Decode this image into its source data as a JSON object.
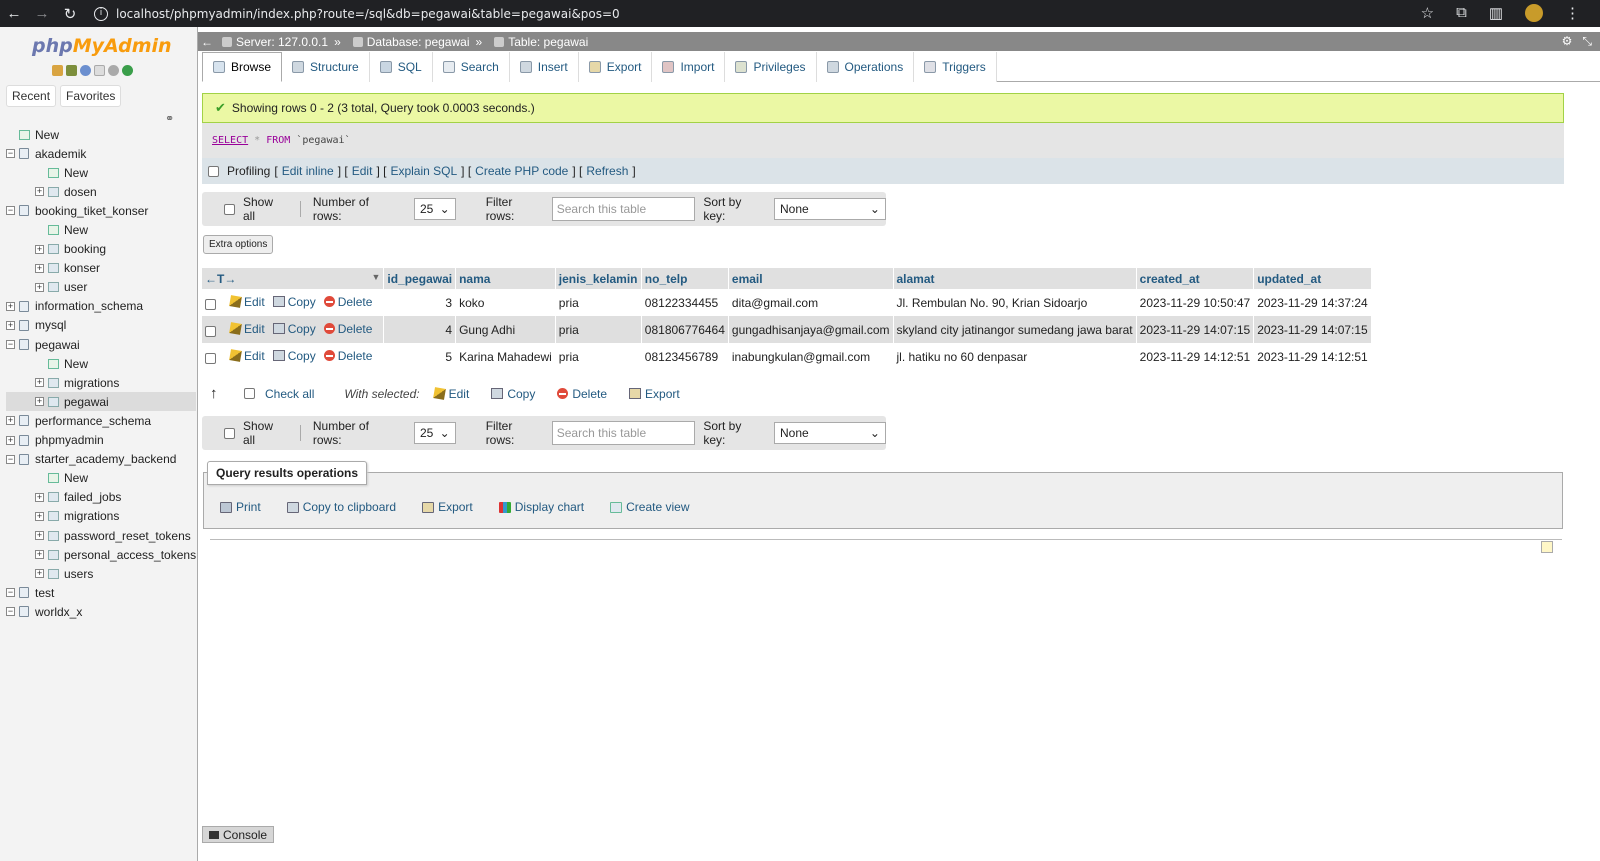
{
  "browser": {
    "url": "localhost/phpmyadmin/index.php?route=/sql&db=pegawai&table=pegawai&pos=0"
  },
  "sidebar": {
    "logo_php": "php",
    "logo_myadmin": "MyAdmin",
    "recent": "Recent",
    "favorites": "Favorites",
    "tree": [
      {
        "label": "New",
        "level": 0,
        "type": "new"
      },
      {
        "label": "akademik",
        "level": 0,
        "type": "db"
      },
      {
        "label": "New",
        "level": 1,
        "type": "new"
      },
      {
        "label": "dosen",
        "level": 1,
        "type": "table"
      },
      {
        "label": "booking_tiket_konser",
        "level": 0,
        "type": "db"
      },
      {
        "label": "New",
        "level": 1,
        "type": "new"
      },
      {
        "label": "booking",
        "level": 1,
        "type": "table"
      },
      {
        "label": "konser",
        "level": 1,
        "type": "table"
      },
      {
        "label": "user",
        "level": 1,
        "type": "table"
      },
      {
        "label": "information_schema",
        "level": 0,
        "type": "db"
      },
      {
        "label": "mysql",
        "level": 0,
        "type": "db"
      },
      {
        "label": "pegawai",
        "level": 0,
        "type": "db"
      },
      {
        "label": "New",
        "level": 1,
        "type": "new"
      },
      {
        "label": "migrations",
        "level": 1,
        "type": "table"
      },
      {
        "label": "pegawai",
        "level": 1,
        "type": "table",
        "active": true
      },
      {
        "label": "performance_schema",
        "level": 0,
        "type": "db"
      },
      {
        "label": "phpmyadmin",
        "level": 0,
        "type": "db"
      },
      {
        "label": "starter_academy_backend",
        "level": 0,
        "type": "db"
      },
      {
        "label": "New",
        "level": 1,
        "type": "new"
      },
      {
        "label": "failed_jobs",
        "level": 1,
        "type": "table"
      },
      {
        "label": "migrations",
        "level": 1,
        "type": "table"
      },
      {
        "label": "password_reset_tokens",
        "level": 1,
        "type": "table"
      },
      {
        "label": "personal_access_tokens",
        "level": 1,
        "type": "table"
      },
      {
        "label": "users",
        "level": 1,
        "type": "table"
      },
      {
        "label": "test",
        "level": 0,
        "type": "db"
      },
      {
        "label": "worldx_x",
        "level": 0,
        "type": "db"
      }
    ]
  },
  "breadcrumb": {
    "server": "Server: 127.0.0.1",
    "database": "Database: pegawai",
    "table": "Table: pegawai",
    "sep": "»"
  },
  "tabs": [
    "Browse",
    "Structure",
    "SQL",
    "Search",
    "Insert",
    "Export",
    "Import",
    "Privileges",
    "Operations",
    "Triggers"
  ],
  "result": {
    "message": "Showing rows 0 - 2 (3 total, Query took 0.0003 seconds.)",
    "sql_select": "SELECT",
    "sql_star": "*",
    "sql_from": "FROM",
    "sql_table": "`pegawai`"
  },
  "profiling": {
    "label": "Profiling",
    "lb": "[",
    "rb": "]",
    "sep": "] [",
    "links": [
      "Edit inline",
      "Edit",
      "Explain SQL",
      "Create PHP code",
      "Refresh"
    ]
  },
  "nav": {
    "show_all": "Show all",
    "number_of_rows": "Number of rows:",
    "rows_value": "25",
    "filter_rows": "Filter rows:",
    "filter_placeholder": "Search this table",
    "sort_by_key": "Sort by key:",
    "sort_value": "None"
  },
  "extra_options": "Extra options",
  "table": {
    "columns": [
      "id_pegawai",
      "nama",
      "jenis_kelamin",
      "no_telp",
      "email",
      "alamat",
      "created_at",
      "updated_at"
    ],
    "action_labels": {
      "edit": "Edit",
      "copy": "Copy",
      "delete": "Delete"
    },
    "rows": [
      [
        "3",
        "koko",
        "pria",
        "08122334455",
        "dita@gmail.com",
        "Jl. Rembulan No. 90, Krian Sidoarjo",
        "2023-11-29 10:50:47",
        "2023-11-29 14:37:24"
      ],
      [
        "4",
        "Gung Adhi",
        "pria",
        "081806776464",
        "gungadhisanjaya@gmail.com",
        "skyland city jatinangor sumedang jawa barat",
        "2023-11-29 14:07:15",
        "2023-11-29 14:07:15"
      ],
      [
        "5",
        "Karina Mahadewi",
        "pria",
        "08123456789",
        "inabungkulan@gmail.com",
        "jl. hatiku no 60 denpasar",
        "2023-11-29 14:12:51",
        "2023-11-29 14:12:51"
      ]
    ]
  },
  "with_selected": {
    "check_all": "Check all",
    "label": "With selected:",
    "edit": "Edit",
    "copy": "Copy",
    "delete": "Delete",
    "export": "Export"
  },
  "query_ops": {
    "legend": "Query results operations",
    "print": "Print",
    "copy_clipboard": "Copy to clipboard",
    "export": "Export",
    "display_chart": "Display chart",
    "create_view": "Create view"
  },
  "console": "Console"
}
